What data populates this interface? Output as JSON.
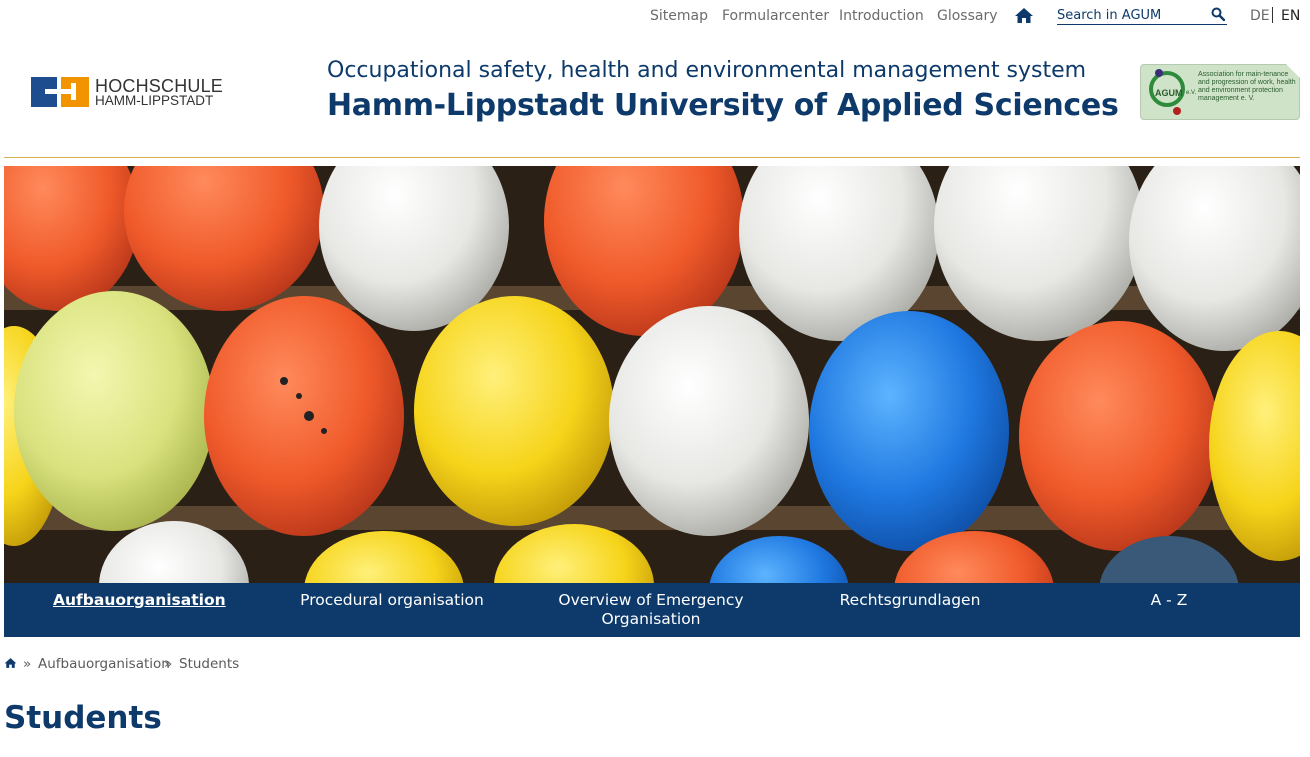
{
  "topnav": {
    "links": [
      "Sitemap",
      "Formularcenter",
      "Introduction",
      "Glossary"
    ],
    "home_icon": "home-icon",
    "search_placeholder": "Search in AGUM",
    "search_icon": "search-icon",
    "lang_de": "DE",
    "lang_en": "EN"
  },
  "logo": {
    "line1": "HOCHSCHULE",
    "line2": "HAMM-LIPPSTADT"
  },
  "header": {
    "subtitle": "Occupational safety, health and environmental management system",
    "title": "Hamm-Lippstadt University of Applied Sciences"
  },
  "agum_badge": {
    "name": "AGUM",
    "suffix": "e.V.",
    "description": "Association for main-tenance and progression of work, health and environment protection management e. V."
  },
  "mainnav": {
    "items": [
      "Aufbauorganisation",
      "Procedural organisation",
      "Overview of Emergency Organisation",
      "Rechtsgrundlagen",
      "A - Z"
    ],
    "active": "Aufbauorganisation"
  },
  "breadcrumb": {
    "home_icon": "home-icon",
    "separator": "»",
    "items": [
      "Aufbauorganisation",
      "Students"
    ]
  },
  "page": {
    "title": "Students"
  },
  "colors": {
    "primary": "#0d3a6b",
    "accent_rule": "#d4b14a",
    "hs_blue": "#1d4c8f",
    "hs_orange": "#f29400"
  }
}
